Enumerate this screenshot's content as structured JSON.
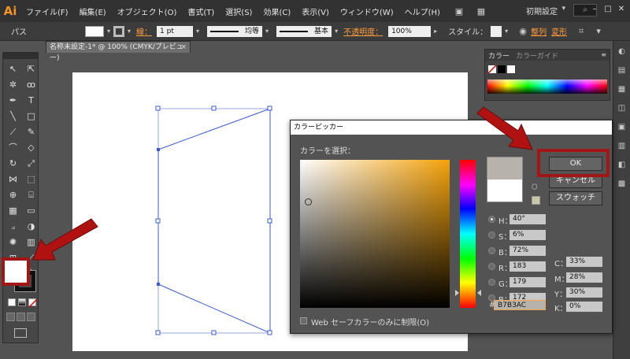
{
  "app": {
    "logo": "Ai"
  },
  "menubar": {
    "items": [
      "ファイル(F)",
      "編集(E)",
      "オブジェクト(O)",
      "書式(T)",
      "選択(S)",
      "効果(C)",
      "表示(V)",
      "ウィンドウ(W)",
      "ヘルプ(H)"
    ],
    "workspace": "初期設定",
    "workspace_caret": "▾",
    "search_icon": "search-icon",
    "window_buttons": [
      "–",
      "□",
      "✕"
    ]
  },
  "controlbar": {
    "label": "パス",
    "stroke_label": "線：",
    "stroke_weight": "1 pt",
    "variable_width": "均等",
    "brush": "基本",
    "opacity_label": "不透明度：",
    "opacity_value": "100%",
    "style_label": "スタイル：",
    "align_label": "整列",
    "transform_label": "変形"
  },
  "document": {
    "tab_title": "名称未設定-1* @ 100% (CMYK/プレビュー)",
    "close": "×"
  },
  "color_panel": {
    "tabs": [
      "カラー",
      "カラーガイド"
    ],
    "menu_icon": "≡"
  },
  "color_picker": {
    "title": "カラーピッカー",
    "subtitle": "カラーを選択：",
    "ok": "OK",
    "cancel": "キャンセル",
    "swatches": "スウォッチ",
    "hsb": [
      {
        "label": "H：",
        "value": "40°",
        "selected": true
      },
      {
        "label": "S：",
        "value": "6%",
        "selected": false
      },
      {
        "label": "B：",
        "value": "72%",
        "selected": false
      }
    ],
    "rgb": [
      {
        "label": "R：",
        "value": "183"
      },
      {
        "label": "G：",
        "value": "179"
      },
      {
        "label": "B：",
        "value": "172"
      }
    ],
    "cmyk": [
      {
        "label": "C：",
        "value": "33%"
      },
      {
        "label": "M：",
        "value": "28%"
      },
      {
        "label": "Y：",
        "value": "30%"
      },
      {
        "label": "K：",
        "value": "0%"
      }
    ],
    "hex_label": "#",
    "hex": "B7B3AC",
    "websafe_label": "Web セーフカラーのみに制限(O)",
    "colors": {
      "new": "#b7b3ac",
      "old": "#ffffff",
      "hue": "#f5a20a"
    }
  },
  "colors": {
    "highlight": "#a31616",
    "accent_orange": "#f7931e",
    "selection_blue": "#3b5bcc"
  }
}
